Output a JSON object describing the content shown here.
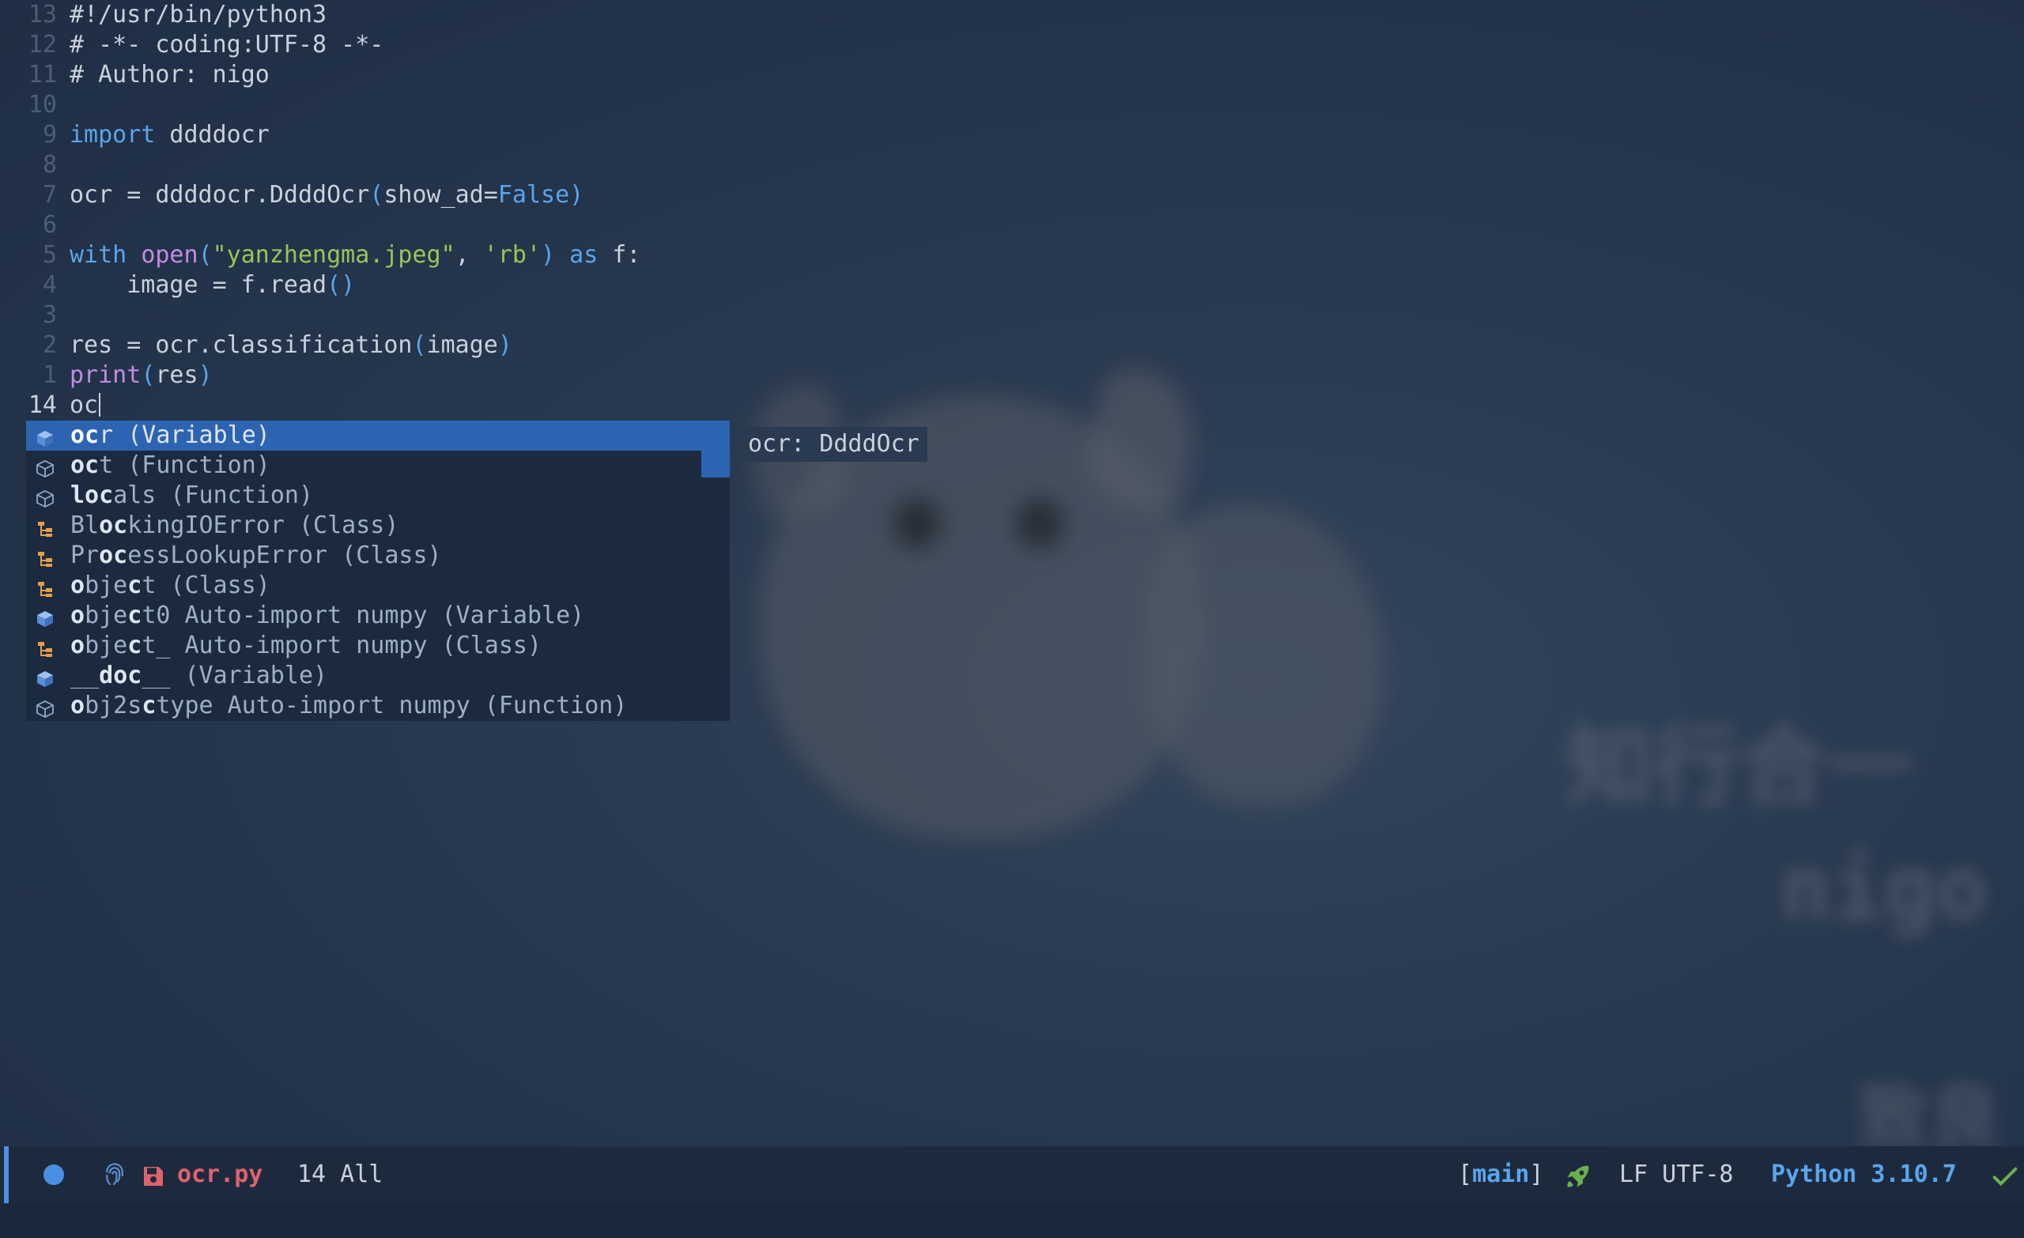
{
  "editor": {
    "lines": [
      {
        "num": "13",
        "parts": [
          {
            "t": "#!/usr/bin/python3",
            "c": ""
          }
        ]
      },
      {
        "num": "12",
        "parts": [
          {
            "t": "# -*- coding:UTF-8 -*-",
            "c": ""
          }
        ]
      },
      {
        "num": "11",
        "parts": [
          {
            "t": "# Author: nigo",
            "c": ""
          }
        ]
      },
      {
        "num": "10",
        "parts": []
      },
      {
        "num": "9",
        "parts": [
          {
            "t": "import",
            "c": "kw"
          },
          {
            "t": " ddddocr",
            "c": ""
          }
        ]
      },
      {
        "num": "8",
        "parts": []
      },
      {
        "num": "7",
        "parts": [
          {
            "t": "ocr = ddddocr.DdddOcr",
            "c": ""
          },
          {
            "t": "(",
            "c": "br"
          },
          {
            "t": "show_ad=",
            "c": ""
          },
          {
            "t": "False",
            "c": "kw"
          },
          {
            "t": ")",
            "c": "br"
          }
        ]
      },
      {
        "num": "6",
        "parts": []
      },
      {
        "num": "5",
        "parts": [
          {
            "t": "with",
            "c": "kw"
          },
          {
            "t": " ",
            "c": ""
          },
          {
            "t": "open",
            "c": "fn"
          },
          {
            "t": "(",
            "c": "br"
          },
          {
            "t": "\"yanzhengma.jpeg\"",
            "c": "str"
          },
          {
            "t": ", ",
            "c": ""
          },
          {
            "t": "'rb'",
            "c": "str"
          },
          {
            "t": ")",
            "c": "br"
          },
          {
            "t": " ",
            "c": ""
          },
          {
            "t": "as",
            "c": "kw"
          },
          {
            "t": " f:",
            "c": ""
          }
        ]
      },
      {
        "num": "4",
        "parts": [
          {
            "t": "    image = f.read",
            "c": ""
          },
          {
            "t": "()",
            "c": "br"
          }
        ]
      },
      {
        "num": "3",
        "parts": []
      },
      {
        "num": "2",
        "parts": [
          {
            "t": "res = ocr.classification",
            "c": ""
          },
          {
            "t": "(",
            "c": "br"
          },
          {
            "t": "image",
            "c": ""
          },
          {
            "t": ")",
            "c": "br"
          }
        ]
      },
      {
        "num": "1",
        "parts": [
          {
            "t": "print",
            "c": "fn"
          },
          {
            "t": "(",
            "c": "br"
          },
          {
            "t": "res",
            "c": ""
          },
          {
            "t": ")",
            "c": "br"
          }
        ]
      },
      {
        "num": "14",
        "current": true,
        "parts": [
          {
            "t": "oc",
            "c": ""
          }
        ]
      }
    ]
  },
  "completion": {
    "items": [
      {
        "kind": "variable",
        "segs": [
          [
            "oc",
            1
          ],
          [
            "r (Variable)",
            0
          ]
        ],
        "selected": true
      },
      {
        "kind": "function",
        "segs": [
          [
            "oc",
            1
          ],
          [
            "t (Function)",
            0
          ]
        ]
      },
      {
        "kind": "function",
        "segs": [
          [
            "lo",
            1
          ],
          [
            "c",
            1
          ],
          [
            "als (Function)",
            0
          ]
        ]
      },
      {
        "kind": "class",
        "segs": [
          [
            "Bl",
            0
          ],
          [
            "oc",
            1
          ],
          [
            "kingIOError (Class)",
            0
          ]
        ]
      },
      {
        "kind": "class",
        "segs": [
          [
            "Pr",
            0
          ],
          [
            "oc",
            1
          ],
          [
            "essLookupError (Class)",
            0
          ]
        ]
      },
      {
        "kind": "class",
        "segs": [
          [
            "o",
            1
          ],
          [
            "bje",
            0
          ],
          [
            "c",
            1
          ],
          [
            "t (Class)",
            0
          ]
        ]
      },
      {
        "kind": "variable",
        "segs": [
          [
            "o",
            1
          ],
          [
            "bje",
            0
          ],
          [
            "c",
            1
          ],
          [
            "t0 Auto-import numpy (Variable)",
            0
          ]
        ]
      },
      {
        "kind": "class",
        "segs": [
          [
            "o",
            1
          ],
          [
            "bje",
            0
          ],
          [
            "c",
            1
          ],
          [
            "t_ Auto-import numpy (Class)",
            0
          ]
        ]
      },
      {
        "kind": "variable",
        "segs": [
          [
            "__",
            0
          ],
          [
            "d",
            1
          ],
          [
            "oc",
            1
          ],
          [
            "__ (Variable)",
            0
          ]
        ]
      },
      {
        "kind": "function",
        "segs": [
          [
            "o",
            1
          ],
          [
            "bj2s",
            0
          ],
          [
            "c",
            1
          ],
          [
            "type Auto-import numpy (Function)",
            0
          ]
        ]
      }
    ],
    "doc": "ocr: DdddOcr"
  },
  "statusbar": {
    "filename": "ocr.py",
    "position": "14 All",
    "branch_open": "[",
    "branch": "main",
    "branch_close": "]",
    "encoding": "LF UTF-8",
    "python": "Python 3.10.7"
  },
  "wallpaper": {
    "text1": "知行合一",
    "text2": "nigo",
    "text3": "致良"
  },
  "colors": {
    "background": "#243449",
    "selection": "#2c64b2",
    "keyword": "#5aa5ec",
    "string": "#9cc35a",
    "builtin": "#c18ce3",
    "filename": "#e0626c",
    "class_icon": "#e2a04a"
  }
}
